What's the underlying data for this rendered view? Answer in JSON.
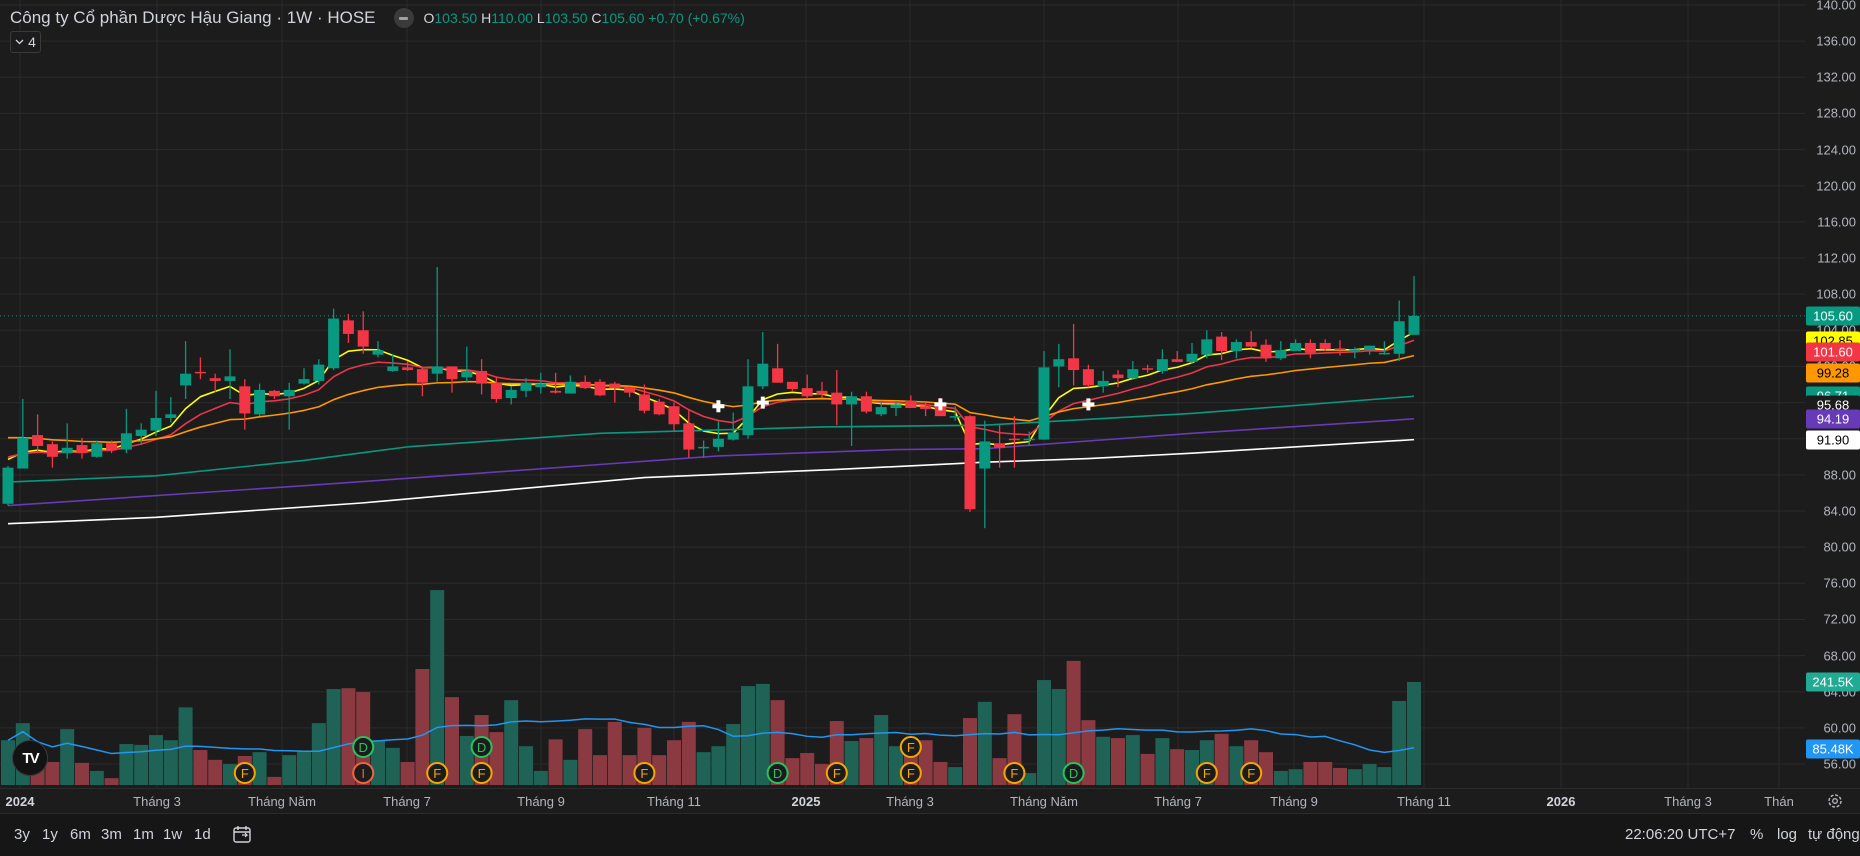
{
  "header": {
    "title": "Công ty Cổ phần Dược Hậu Giang · 1W · HOSE",
    "o_label": "O",
    "o_value": "103.50",
    "h_label": "H",
    "h_value": "110.00",
    "l_label": "L",
    "l_value": "103.50",
    "c_label": "C",
    "c_value": "105.60",
    "change": "+0.70 (+0.67%)",
    "indicators_count": "4"
  },
  "colors": {
    "up": "#089981",
    "down": "#f23645",
    "vol_up": "#1f6356",
    "vol_down": "#8b3a41",
    "vol_ma": "#2196f3",
    "ma_fast": "#ffff00",
    "ma_mid": "#e8374a",
    "ma_slow": "#ff9800",
    "ma_teal": "#089981",
    "ma_purple": "#673ab7",
    "ma_white": "#ffffff"
  },
  "price_ticks": [
    "140.00",
    "136.00",
    "132.00",
    "128.00",
    "124.00",
    "120.00",
    "116.00",
    "112.00",
    "108.00",
    "104.00",
    "100.00",
    "96.00",
    "92.00",
    "88.00",
    "84.00",
    "80.00",
    "76.00",
    "72.00",
    "68.00",
    "64.00",
    "60.00",
    "56.00"
  ],
  "price_badges": [
    {
      "text": "105.60",
      "value": 105.6,
      "bg": "#089981",
      "fg": "#ffffff"
    },
    {
      "text": "102.85",
      "value": 102.85,
      "bg": "#ffff00",
      "fg": "#000000"
    },
    {
      "text": "101.60",
      "value": 101.6,
      "bg": "#f23645",
      "fg": "#ffffff"
    },
    {
      "text": "99.28",
      "value": 99.28,
      "bg": "#ff9800",
      "fg": "#000000"
    },
    {
      "text": "96.71",
      "value": 96.71,
      "bg": "#089981",
      "fg": "#ffffff"
    },
    {
      "text": "95.68",
      "value": 95.68,
      "bg": "#1c1c1c",
      "fg": "#ffffff"
    },
    {
      "text": "94.19",
      "value": 94.19,
      "bg": "#673ab7",
      "fg": "#ffffff"
    },
    {
      "text": "91.90",
      "value": 91.9,
      "bg": "#ffffff",
      "fg": "#000000"
    }
  ],
  "volume_badges": [
    {
      "text": "241.5K",
      "value": 241.5,
      "bg": "#22ab94",
      "fg": "#ffffff"
    },
    {
      "text": "85.48K",
      "value": 85.48,
      "bg": "#2196f3",
      "fg": "#ffffff"
    }
  ],
  "time_labels": [
    {
      "text": "2024",
      "bold": true
    },
    {
      "text": "Tháng 3"
    },
    {
      "text": "Tháng Năm"
    },
    {
      "text": "Tháng 7"
    },
    {
      "text": "Tháng 9"
    },
    {
      "text": "Tháng 11"
    },
    {
      "text": "2025",
      "bold": true
    },
    {
      "text": "Tháng 3"
    },
    {
      "text": "Tháng Năm"
    },
    {
      "text": "Tháng 7"
    },
    {
      "text": "Tháng 9"
    },
    {
      "text": "Tháng 11"
    },
    {
      "text": "2026",
      "bold": true
    },
    {
      "text": "Tháng 3"
    },
    {
      "text": "Thán"
    }
  ],
  "toolbar": {
    "ranges": [
      "3y",
      "1y",
      "6m",
      "3m",
      "1m",
      "1w",
      "1d"
    ],
    "time": "22:06:20 UTC+7",
    "percent": "%",
    "log": "log",
    "auto": "tự động"
  },
  "logo_text": "TV",
  "chart_data": {
    "type": "candlestick",
    "fields": [
      "open",
      "high",
      "low",
      "close",
      "volume_k"
    ],
    "candles": [
      [
        84.8,
        89.0,
        84.6,
        88.8,
        105
      ],
      [
        88.7,
        96.4,
        88.7,
        92.1,
        145
      ],
      [
        92.4,
        94.7,
        90.4,
        91.2,
        54
      ],
      [
        91.4,
        91.7,
        88.8,
        90.0,
        54
      ],
      [
        90.4,
        93.7,
        89.8,
        91.0,
        131
      ],
      [
        91.3,
        92.1,
        89.8,
        90.4,
        52
      ],
      [
        90.0,
        91.8,
        89.9,
        91.5,
        33
      ],
      [
        91.5,
        91.8,
        90.4,
        90.8,
        16
      ],
      [
        90.8,
        95.3,
        90.4,
        92.6,
        96
      ],
      [
        92.3,
        93.7,
        91.3,
        93.0,
        94
      ],
      [
        92.9,
        97.3,
        92.3,
        94.3,
        117
      ],
      [
        94.3,
        96.6,
        93.8,
        94.7,
        105
      ],
      [
        97.9,
        102.8,
        96.4,
        99.2,
        182
      ],
      [
        99.4,
        101.0,
        98.6,
        99.3,
        82
      ],
      [
        98.7,
        99.2,
        97.2,
        98.4,
        59
      ],
      [
        98.4,
        101.9,
        96.4,
        98.9,
        49
      ],
      [
        97.8,
        98.6,
        93.0,
        94.8,
        68
      ],
      [
        94.7,
        98.1,
        94.5,
        97.4,
        77
      ],
      [
        97.3,
        97.4,
        96.4,
        96.7,
        19
      ],
      [
        96.7,
        98.2,
        93.0,
        97.4,
        70
      ],
      [
        98.1,
        99.8,
        98.0,
        98.6,
        80
      ],
      [
        98.4,
        100.8,
        98.0,
        100.2,
        145
      ],
      [
        99.8,
        106.4,
        99.6,
        105.3,
        225
      ],
      [
        105.1,
        105.8,
        102.6,
        103.6,
        227
      ],
      [
        104.0,
        106.1,
        101.4,
        102.2,
        218
      ],
      [
        101.3,
        102.8,
        101.0,
        101.8,
        105
      ],
      [
        99.5,
        101.4,
        99.4,
        100.0,
        87
      ],
      [
        99.9,
        100.6,
        99.5,
        99.6,
        54
      ],
      [
        99.7,
        100.0,
        96.7,
        98.2,
        272
      ],
      [
        99.2,
        111.0,
        98.3,
        100.0,
        457
      ],
      [
        100.0,
        100.0,
        97.1,
        98.6,
        206
      ],
      [
        98.8,
        102.2,
        98.3,
        99.5,
        115
      ],
      [
        99.5,
        100.8,
        96.9,
        98.1,
        164
      ],
      [
        98.2,
        98.9,
        96.0,
        96.4,
        124
      ],
      [
        96.5,
        97.8,
        95.8,
        97.4,
        199
      ],
      [
        97.3,
        98.7,
        96.6,
        98.2,
        91
      ],
      [
        97.7,
        99.3,
        97.0,
        98.1,
        33
      ],
      [
        97.3,
        99.3,
        97.0,
        97.1,
        107
      ],
      [
        97.0,
        99.0,
        97.0,
        98.3,
        59
      ],
      [
        98.3,
        99.0,
        97.5,
        97.6,
        131
      ],
      [
        98.3,
        98.6,
        96.7,
        96.8,
        70
      ],
      [
        98.1,
        98.3,
        96.0,
        97.6,
        148
      ],
      [
        97.7,
        97.8,
        96.6,
        97.1,
        70
      ],
      [
        96.9,
        98.0,
        94.8,
        95.1,
        134
      ],
      [
        96.1,
        96.4,
        94.6,
        94.7,
        70
      ],
      [
        95.6,
        96.0,
        92.9,
        93.6,
        105
      ],
      [
        93.7,
        95.3,
        89.9,
        90.8,
        148
      ],
      [
        91.0,
        91.8,
        89.9,
        91.1,
        77
      ],
      [
        91.1,
        93.9,
        90.6,
        92.0,
        91
      ],
      [
        91.9,
        94.9,
        91.8,
        92.7,
        143
      ],
      [
        92.4,
        100.8,
        92.0,
        97.8,
        232
      ],
      [
        97.8,
        103.8,
        97.5,
        100.3,
        237
      ],
      [
        99.8,
        102.5,
        98.2,
        98.2,
        199
      ],
      [
        98.3,
        98.3,
        97.3,
        97.5,
        63
      ],
      [
        97.6,
        99.1,
        96.4,
        96.7,
        75
      ],
      [
        97.3,
        98.3,
        96.5,
        96.9,
        49
      ],
      [
        97.1,
        99.6,
        93.5,
        95.8,
        150
      ],
      [
        95.8,
        97.2,
        91.2,
        96.7,
        103
      ],
      [
        96.7,
        97.2,
        94.8,
        95.0,
        110
      ],
      [
        94.7,
        96.2,
        94.5,
        95.5,
        164
      ],
      [
        95.4,
        96.2,
        94.5,
        95.8,
        91
      ],
      [
        96.2,
        96.8,
        95.4,
        95.4,
        70
      ],
      [
        95.6,
        96.0,
        94.5,
        95.3,
        105
      ],
      [
        95.8,
        96.5,
        94.5,
        94.5,
        54
      ],
      [
        94.4,
        95.6,
        94.0,
        94.5,
        42
      ],
      [
        94.5,
        94.6,
        83.9,
        84.2,
        157
      ],
      [
        88.7,
        94.0,
        82.1,
        91.7,
        195
      ],
      [
        91.5,
        93.5,
        88.8,
        91.0,
        63
      ],
      [
        92.0,
        94.5,
        88.8,
        91.9,
        166
      ],
      [
        91.9,
        92.8,
        91.2,
        92.0,
        28
      ],
      [
        91.9,
        101.7,
        91.9,
        99.9,
        246
      ],
      [
        100.0,
        102.5,
        97.7,
        100.8,
        225
      ],
      [
        100.9,
        104.7,
        97.9,
        99.6,
        291
      ],
      [
        99.7,
        100.2,
        97.7,
        97.9,
        152
      ],
      [
        97.8,
        99.5,
        97.1,
        98.4,
        113
      ],
      [
        99.1,
        99.6,
        97.7,
        98.7,
        110
      ],
      [
        98.7,
        100.6,
        98.5,
        99.7,
        117
      ],
      [
        99.8,
        100.2,
        99.3,
        99.7,
        73
      ],
      [
        99.5,
        101.9,
        99.2,
        100.8,
        110
      ],
      [
        100.8,
        101.7,
        100.5,
        100.5,
        84
      ],
      [
        100.5,
        102.6,
        100.3,
        101.4,
        82
      ],
      [
        101.3,
        104.0,
        100.9,
        103.0,
        105
      ],
      [
        103.3,
        103.8,
        100.7,
        101.7,
        120
      ],
      [
        101.7,
        103.0,
        100.9,
        102.7,
        91
      ],
      [
        102.7,
        103.9,
        102.0,
        102.2,
        105
      ],
      [
        102.4,
        103.0,
        100.5,
        100.9,
        77
      ],
      [
        100.9,
        102.8,
        100.7,
        101.8,
        33
      ],
      [
        101.7,
        103.0,
        101.7,
        102.6,
        37
      ],
      [
        102.6,
        103.0,
        100.9,
        101.5,
        54
      ],
      [
        102.6,
        103.0,
        101.7,
        101.9,
        54
      ],
      [
        102.0,
        102.9,
        101.2,
        101.8,
        40
      ],
      [
        101.6,
        102.1,
        100.9,
        101.9,
        37
      ],
      [
        101.8,
        102.3,
        101.3,
        102.3,
        49
      ],
      [
        101.4,
        102.8,
        101.3,
        101.5,
        42
      ],
      [
        101.4,
        107.3,
        100.6,
        105.0,
        197
      ],
      [
        103.5,
        110.0,
        103.5,
        105.6,
        241.5
      ]
    ],
    "last_price": 105.6,
    "price_range": [
      56,
      140
    ],
    "ma_lines": [
      {
        "name": "ma-fast",
        "color": "#ffff00",
        "ema_period": 5
      },
      {
        "name": "ma-mid",
        "color": "#e8374a",
        "ema_period": 10
      },
      {
        "name": "ma-slow",
        "color": "#ff9800",
        "ema_period": 24
      },
      {
        "name": "ma-teal",
        "color": "#089981",
        "points": [
          [
            0,
            87.2
          ],
          [
            10,
            87.9
          ],
          [
            20,
            89.6
          ],
          [
            27,
            91.1
          ],
          [
            40,
            92.6
          ],
          [
            55,
            93.3
          ],
          [
            66,
            93.5
          ],
          [
            80,
            94.8
          ],
          [
            95,
            96.7
          ]
        ]
      },
      {
        "name": "ma-purple",
        "color": "#673ab7",
        "points": [
          [
            0,
            84.6
          ],
          [
            20,
            86.8
          ],
          [
            32,
            88.2
          ],
          [
            48,
            90.1
          ],
          [
            60,
            90.8
          ],
          [
            66,
            90.9
          ],
          [
            80,
            92.6
          ],
          [
            95,
            94.2
          ]
        ]
      },
      {
        "name": "ma-white",
        "color": "#ffffff",
        "points": [
          [
            0,
            82.6
          ],
          [
            10,
            83.3
          ],
          [
            24,
            84.9
          ],
          [
            43,
            87.7
          ],
          [
            56,
            88.6
          ],
          [
            66,
            89.4
          ],
          [
            73,
            89.8
          ],
          [
            80,
            90.4
          ],
          [
            95,
            91.9
          ]
        ]
      }
    ],
    "volume_ma_period": 20,
    "cross_markers": [
      {
        "index": 48,
        "price": 95.6
      },
      {
        "index": 51,
        "price": 96.0
      },
      {
        "index": 63,
        "price": 95.8
      },
      {
        "index": 73,
        "price": 95.8
      }
    ],
    "events": [
      {
        "index": 16,
        "letter": "F",
        "row": 0
      },
      {
        "index": 24,
        "letter": "D",
        "row": 1
      },
      {
        "index": 24,
        "letter": "I",
        "row": 0
      },
      {
        "index": 29,
        "letter": "F",
        "row": 0
      },
      {
        "index": 32,
        "letter": "D",
        "row": 1
      },
      {
        "index": 32,
        "letter": "F",
        "row": 0
      },
      {
        "index": 43,
        "letter": "F",
        "row": 0
      },
      {
        "index": 52,
        "letter": "D",
        "row": 0
      },
      {
        "index": 56,
        "letter": "F",
        "row": 0
      },
      {
        "index": 61,
        "letter": "F",
        "row": 1
      },
      {
        "index": 61,
        "letter": "F",
        "row": 0
      },
      {
        "index": 68,
        "letter": "F",
        "row": 0
      },
      {
        "index": 72,
        "letter": "D",
        "row": 0
      },
      {
        "index": 81,
        "letter": "F",
        "row": 0
      },
      {
        "index": 84,
        "letter": "F",
        "row": 0
      }
    ]
  }
}
